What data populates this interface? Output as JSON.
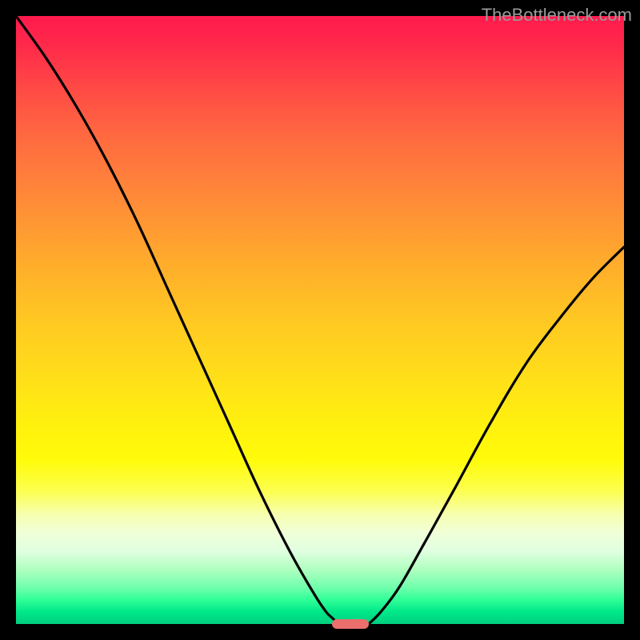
{
  "watermark": "TheBottleneck.com",
  "chart_data": {
    "type": "line",
    "title": "",
    "xlabel": "",
    "ylabel": "",
    "xlim": [
      0,
      100
    ],
    "ylim": [
      0,
      100
    ],
    "series": [
      {
        "name": "left-curve",
        "x": [
          0,
          5,
          10,
          15,
          20,
          25,
          30,
          35,
          40,
          45,
          49,
          51,
          52,
          53
        ],
        "y": [
          100,
          93,
          85,
          76,
          66,
          55,
          44,
          33,
          22,
          12,
          5,
          2,
          1,
          0
        ]
      },
      {
        "name": "right-curve",
        "x": [
          58,
          60,
          63,
          67,
          72,
          78,
          84,
          90,
          95,
          100
        ],
        "y": [
          0,
          2,
          6,
          13,
          22,
          33,
          43,
          51,
          57,
          62
        ]
      }
    ],
    "marker": {
      "x_center": 55,
      "y": 0,
      "width_pct": 6,
      "color": "#ea6f6d"
    },
    "gradient_stops": [
      {
        "pos": 0,
        "color": "#ff1a4d"
      },
      {
        "pos": 50,
        "color": "#ffc822"
      },
      {
        "pos": 80,
        "color": "#fcff4d"
      },
      {
        "pos": 100,
        "color": "#00cf80"
      }
    ]
  }
}
